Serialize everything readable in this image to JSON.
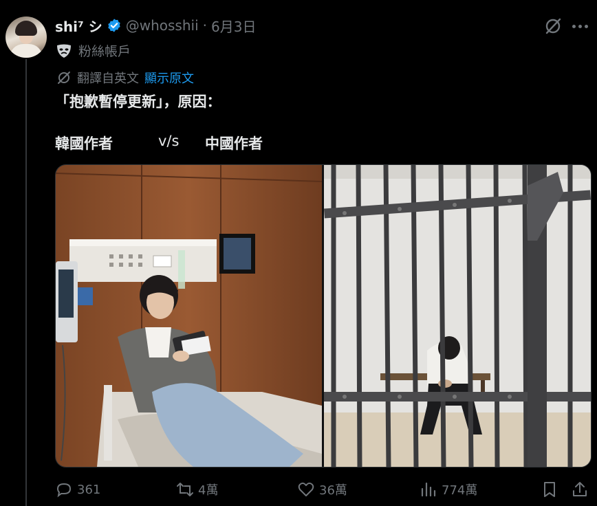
{
  "post": {
    "author_name": "shi⁷ シ",
    "handle": "@whosshii",
    "separator": "·",
    "date": "6月3日",
    "fan_account_label": "粉絲帳戶",
    "translated_from": "翻譯自英文",
    "show_original": "顯示原文",
    "text_line1": "「抱歉暫停更新」，原因：",
    "text_line2_left": "韓國作者",
    "text_line2_mid": "v/s",
    "text_line2_right": "中國作者"
  },
  "actions": {
    "replies": "361",
    "reposts": "4萬",
    "likes": "36萬",
    "views": "774萬"
  },
  "colors": {
    "background": "#000000",
    "text": "#e7e9ea",
    "muted": "#71767b",
    "accent": "#1d9bf0",
    "divider": "#333639"
  },
  "icons": [
    "verified-badge-icon",
    "grok-icon",
    "more-icon",
    "mask-icon",
    "translate-icon",
    "reply-icon",
    "repost-icon",
    "like-icon",
    "views-icon",
    "bookmark-icon",
    "share-icon"
  ]
}
